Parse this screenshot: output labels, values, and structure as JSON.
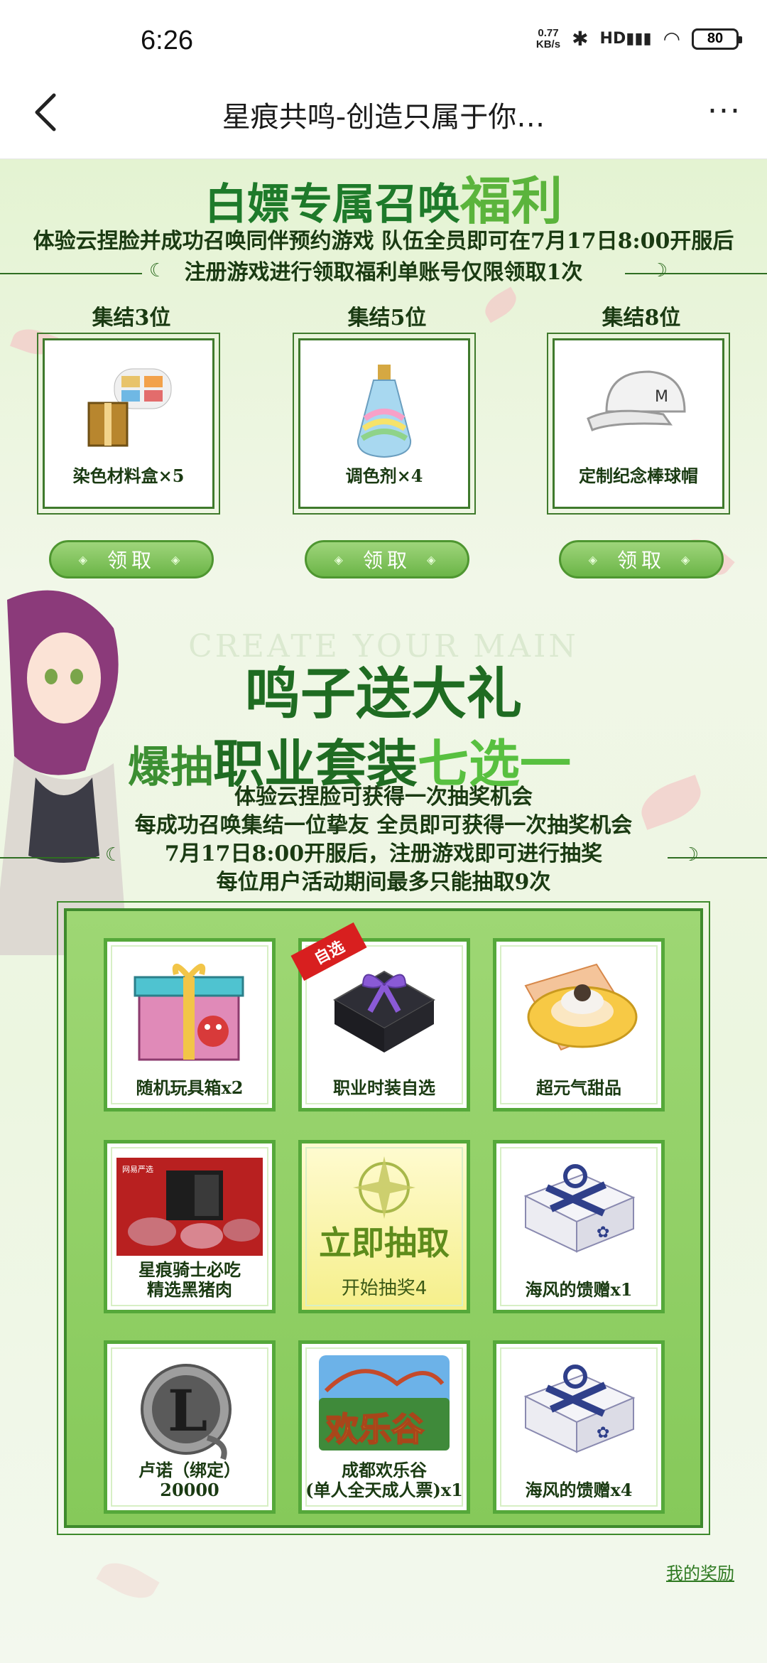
{
  "status": {
    "time": "6:26",
    "netspeed_value": "0.77",
    "netspeed_unit": "KB/s",
    "network": "HD",
    "battery": "80"
  },
  "nav": {
    "title": "星痕共鸣-创造只属于你…"
  },
  "section1": {
    "title_a": "白嫖专属召唤",
    "title_b": "福利",
    "desc1": "体验云捏脸并成功召唤同伴预约游戏 队伍全员即可在7月17日8:00开服后",
    "desc2": "注册游戏进行领取福利单账号仅限领取1次",
    "tiers": [
      {
        "title": "集结3位",
        "reward": "染色材料盒×5",
        "button": "领取"
      },
      {
        "title": "集结5位",
        "reward": "调色剂×4",
        "button": "领取"
      },
      {
        "title": "集结8位",
        "reward": "定制纪念棒球帽",
        "button": "领取"
      }
    ]
  },
  "section2": {
    "watermark": "CREATE YOUR MAIN",
    "title1": "鸣子送大礼",
    "title2_a": "爆抽",
    "title2_b": "职业套装",
    "title2_c": "七选一",
    "desc": [
      "体验云捏脸可获得一次抽奖机会",
      "每成功召唤集结一位挚友 全员即可获得一次抽奖机会",
      "7月17日8:00开服后，注册游戏即可进行抽奖",
      "每位用户活动期间最多只能抽取9次"
    ],
    "prizes": [
      {
        "label": "随机玩具箱x2"
      },
      {
        "label": "职业时装自选",
        "badge": "自选"
      },
      {
        "label": "超元气甜品"
      },
      {
        "label": "星痕骑士必吃\n精选黑猪肉"
      },
      {
        "label": "海风的馈赠x1"
      },
      {
        "label": "卢诺（绑定）\n20000"
      },
      {
        "label": "成都欢乐谷\n(单人全天成人票)x1"
      },
      {
        "label": "海风的馈赠x4"
      }
    ],
    "center": {
      "title": "立即抽取",
      "sub": "开始抽奖4"
    },
    "my_rewards": "我的奖励"
  }
}
